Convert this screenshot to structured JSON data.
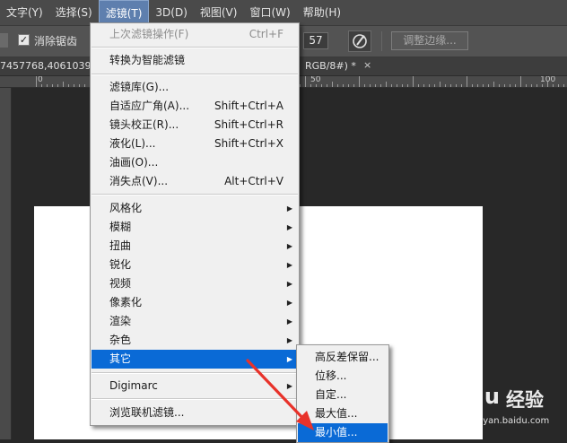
{
  "menubar": {
    "items": [
      "文字(Y)",
      "选择(S)",
      "滤镜(T)",
      "3D(D)",
      "视图(V)",
      "窗口(W)",
      "帮助(H)"
    ],
    "active_index": 2
  },
  "options": {
    "antialias_label": "消除锯齿",
    "antialias_checked": "✓",
    "value": "57",
    "refine_edge_label": "调整边缘..."
  },
  "document": {
    "tab_left": "7457768,4061039",
    "tab_right": "RGB/8#) *",
    "close_glyph": "×"
  },
  "ruler": {
    "label_0": "0",
    "label_50": "50",
    "label_100": "100"
  },
  "filter_menu": {
    "last_filter": {
      "label": "上次滤镜操作(F)",
      "shortcut": "Ctrl+F"
    },
    "convert_smart": "转换为智能滤镜",
    "gallery": "滤镜库(G)...",
    "adaptive_wide": {
      "label": "自适应广角(A)...",
      "shortcut": "Shift+Ctrl+A"
    },
    "lens_correction": {
      "label": "镜头校正(R)...",
      "shortcut": "Shift+Ctrl+R"
    },
    "liquify": {
      "label": "液化(L)...",
      "shortcut": "Shift+Ctrl+X"
    },
    "oil_paint": "油画(O)...",
    "vanishing_point": {
      "label": "消失点(V)...",
      "shortcut": "Alt+Ctrl+V"
    },
    "stylize": "风格化",
    "blur": "模糊",
    "distort": "扭曲",
    "sharpen": "锐化",
    "video": "视频",
    "pixelate": "像素化",
    "render": "渲染",
    "noise": "杂色",
    "other": "其它",
    "digimarc": "Digimarc",
    "browse_online": "浏览联机滤镜...",
    "arrow": "▶"
  },
  "other_submenu": {
    "high_pass": "高反差保留...",
    "offset": "位移...",
    "custom": "自定...",
    "maximum": "最大值...",
    "minimum": "最小值..."
  },
  "colors": {
    "highlight": "#0a6ad6",
    "arrow": "#e8322a"
  },
  "watermark": {
    "logo": "Baidu",
    "brand": "经验",
    "url": "jingyan.baidu.com"
  }
}
